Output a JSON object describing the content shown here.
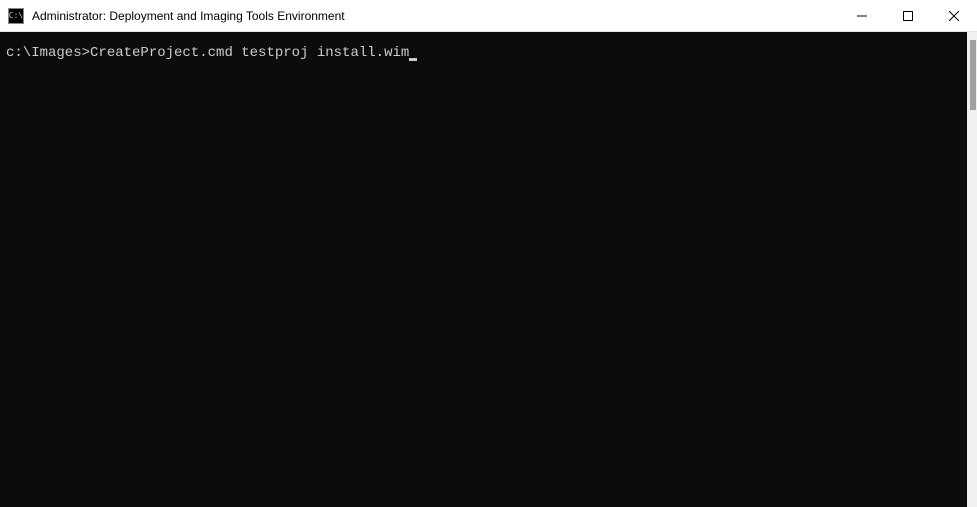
{
  "window": {
    "title": "Administrator: Deployment and Imaging Tools Environment",
    "icon_label": "C:\\"
  },
  "terminal": {
    "prompt": "c:\\Images>",
    "command": "CreateProject.cmd testproj install.wim"
  }
}
